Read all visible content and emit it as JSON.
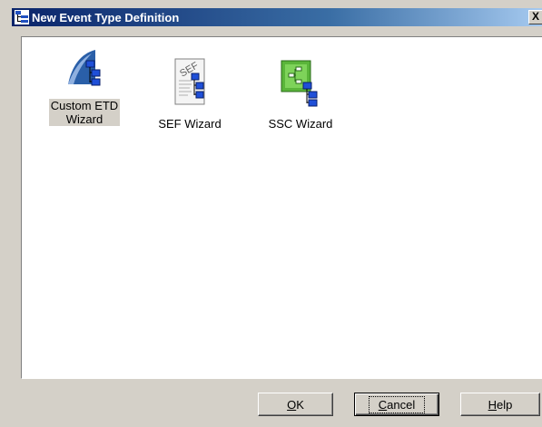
{
  "window": {
    "title": "New Event Type Definition",
    "close_label": "X"
  },
  "wizards": [
    {
      "label_line1": "Custom ETD",
      "label_line2": "Wizard",
      "icon": "custom-etd-wizard-icon",
      "selected": true
    },
    {
      "label_line1": "SEF Wizard",
      "label_line2": "",
      "icon": "sef-wizard-icon",
      "selected": false
    },
    {
      "label_line1": "SSC Wizard",
      "label_line2": "",
      "icon": "ssc-wizard-icon",
      "selected": false
    }
  ],
  "buttons": {
    "ok_mnemonic": "O",
    "ok_rest": "K",
    "cancel_mnemonic": "C",
    "cancel_rest": "ancel",
    "help_mnemonic": "H",
    "help_rest": "elp"
  },
  "colors": {
    "title_bar_start": "#0a246a",
    "title_bar_end": "#a6caf0",
    "dialog_face": "#d4d0c8",
    "content_background": "#ffffff"
  }
}
